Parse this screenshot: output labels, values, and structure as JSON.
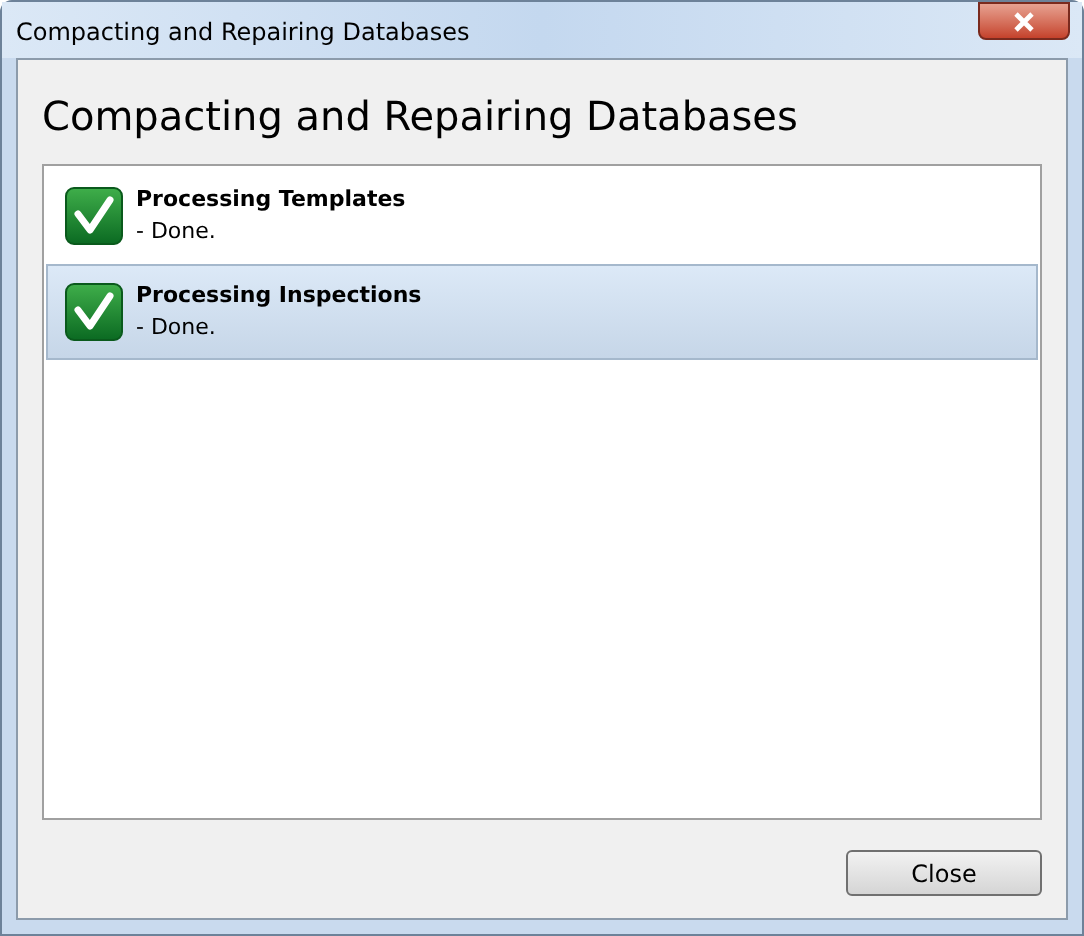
{
  "window": {
    "title": "Compacting and Repairing Databases"
  },
  "heading": "Compacting and Repairing Databases",
  "tasks": [
    {
      "title": "Processing Templates",
      "status": "- Done.",
      "selected": false
    },
    {
      "title": "Processing Inspections",
      "status": "- Done.",
      "selected": true
    }
  ],
  "buttons": [
    "Close"
  ]
}
